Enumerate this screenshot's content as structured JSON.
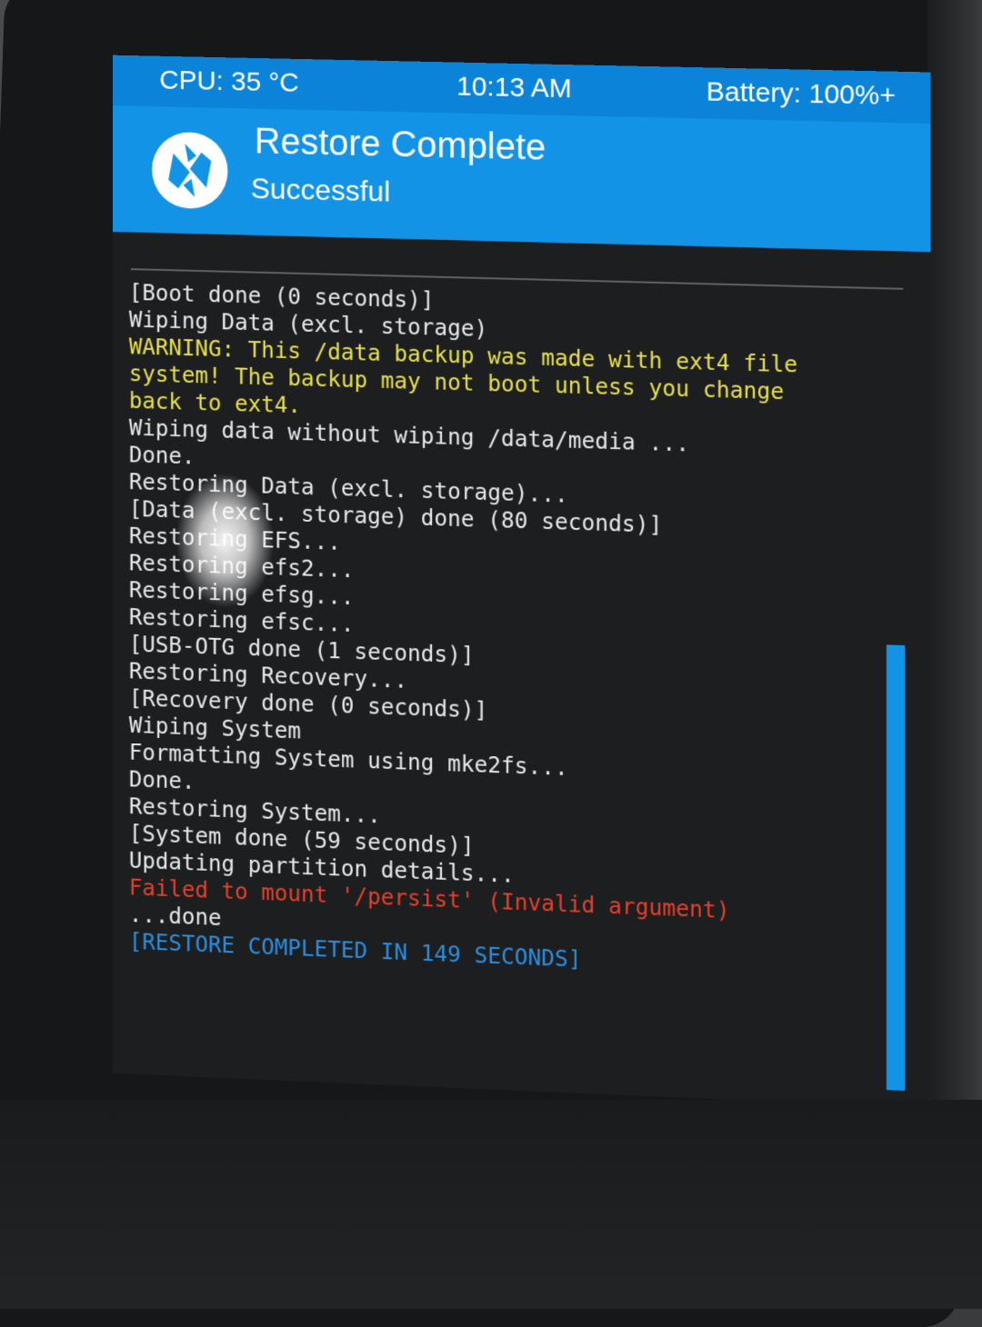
{
  "status_bar": {
    "cpu": "CPU: 35 °C",
    "time": "10:13 AM",
    "battery": "Battery: 100%+"
  },
  "header": {
    "title": "Restore Complete",
    "subtitle": "Successful",
    "logo_icon": "twrp-logo-icon"
  },
  "colors": {
    "status_bar": "#0b83d8",
    "header": "#1393e6",
    "console_bg": "#1d1e20",
    "warning": "#e8e14a",
    "error": "#e6402b",
    "complete": "#2b8fe0"
  },
  "console": {
    "lines": [
      {
        "text": "[Boot done (0 seconds)]",
        "kind": "normal"
      },
      {
        "text": "Wiping Data (excl. storage)",
        "kind": "normal"
      },
      {
        "text": "WARNING: This /data backup was made with ext4 file",
        "kind": "warning"
      },
      {
        "text": "system! The backup may not boot unless you change",
        "kind": "warning"
      },
      {
        "text": "back to ext4.",
        "kind": "warning"
      },
      {
        "text": "Wiping data without wiping /data/media ...",
        "kind": "normal"
      },
      {
        "text": "Done.",
        "kind": "normal"
      },
      {
        "text": "Restoring Data (excl. storage)...",
        "kind": "normal"
      },
      {
        "text": "[Data (excl. storage) done (80 seconds)]",
        "kind": "normal"
      },
      {
        "text": "Restoring EFS...",
        "kind": "normal"
      },
      {
        "text": "Restoring efs2...",
        "kind": "normal"
      },
      {
        "text": "Restoring efsg...",
        "kind": "normal"
      },
      {
        "text": "Restoring efsc...",
        "kind": "normal"
      },
      {
        "text": "[USB-OTG done (1 seconds)]",
        "kind": "normal"
      },
      {
        "text": "Restoring Recovery...",
        "kind": "normal"
      },
      {
        "text": "[Recovery done (0 seconds)]",
        "kind": "normal"
      },
      {
        "text": "Wiping System",
        "kind": "normal"
      },
      {
        "text": "Formatting System using mke2fs...",
        "kind": "normal"
      },
      {
        "text": "Done.",
        "kind": "normal"
      },
      {
        "text": "Restoring System...",
        "kind": "normal"
      },
      {
        "text": "[System done (59 seconds)]",
        "kind": "normal"
      },
      {
        "text": "Updating partition details...",
        "kind": "normal"
      },
      {
        "text": "Failed to mount '/persist' (Invalid argument)",
        "kind": "error"
      },
      {
        "text": "...done",
        "kind": "normal"
      },
      {
        "text": "[RESTORE COMPLETED IN 149 SECONDS]",
        "kind": "complete"
      }
    ]
  }
}
